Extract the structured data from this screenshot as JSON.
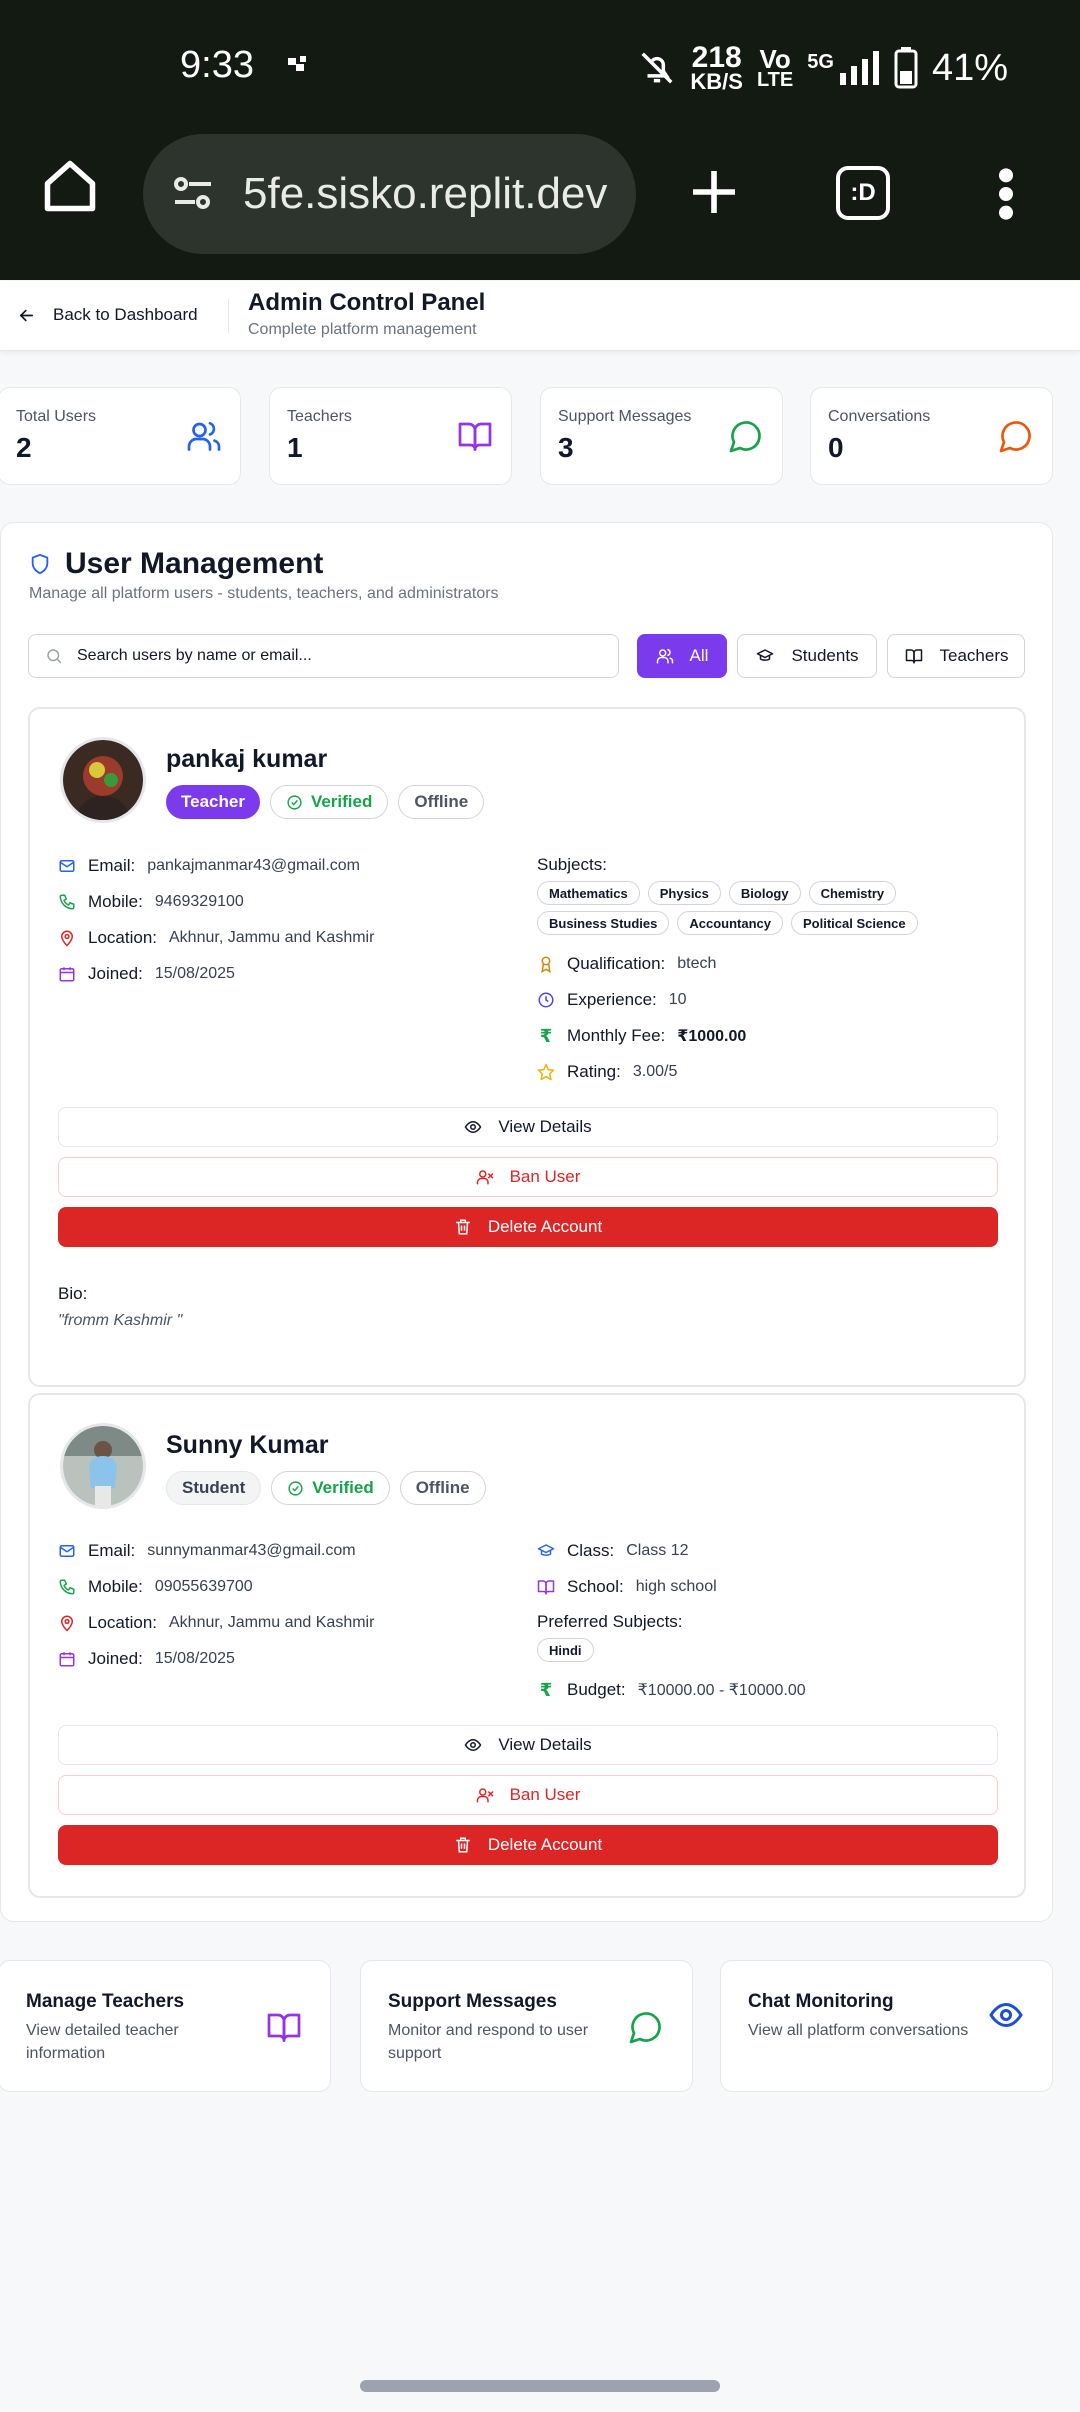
{
  "status_bar": {
    "time": "9:33",
    "net_speed_value": "218",
    "net_speed_unit": "KB/S",
    "volte_top": "Vo",
    "volte_bottom": "LTE",
    "network": "5G",
    "battery": "41%"
  },
  "browser": {
    "url": "5fe.sisko.replit.dev",
    "tabs_label": ":D"
  },
  "header": {
    "back_label": "Back to Dashboard",
    "title": "Admin Control Panel",
    "subtitle": "Complete platform management"
  },
  "stats": [
    {
      "label": "Total Users",
      "value": "2",
      "icon": "users-icon",
      "color": "#2563eb"
    },
    {
      "label": "Teachers",
      "value": "1",
      "icon": "book-open-icon",
      "color": "#9333ea"
    },
    {
      "label": "Support Messages",
      "value": "3",
      "icon": "message-circle-icon",
      "color": "#16a34a"
    },
    {
      "label": "Conversations",
      "value": "0",
      "icon": "message-circle-icon",
      "color": "#ea580c"
    }
  ],
  "user_management": {
    "title": "User Management",
    "subtitle": "Manage all platform users - students, teachers, and administrators",
    "search_placeholder": "Search users by name or email...",
    "filters": {
      "all": "All",
      "students": "Students",
      "teachers": "Teachers"
    }
  },
  "labels": {
    "email": "Email:",
    "mobile": "Mobile:",
    "location": "Location:",
    "joined": "Joined:",
    "subjects": "Subjects:",
    "qualification": "Qualification:",
    "experience": "Experience:",
    "monthly_fee": "Monthly Fee:",
    "rating": "Rating:",
    "class": "Class:",
    "school": "School:",
    "preferred_subjects": "Preferred Subjects:",
    "budget": "Budget:",
    "view_details": "View Details",
    "ban_user": "Ban User",
    "delete_account": "Delete Account",
    "bio": "Bio:"
  },
  "users": [
    {
      "name": "pankaj kumar",
      "role": "Teacher",
      "verified": "Verified",
      "presence": "Offline",
      "email": "pankajmanmar43@gmail.com",
      "mobile": "9469329100",
      "location": "Akhnur, Jammu and Kashmir",
      "joined": "15/08/2025",
      "subjects": [
        "Mathematics",
        "Physics",
        "Biology",
        "Chemistry",
        "Business Studies",
        "Accountancy",
        "Political Science"
      ],
      "qualification": "btech",
      "experience": "10",
      "monthly_fee": "₹1000.00",
      "rating": "3.00/5",
      "bio": "\"fromm Kashmir \""
    },
    {
      "name": "Sunny Kumar",
      "role": "Student",
      "verified": "Verified",
      "presence": "Offline",
      "email": "sunnymanmar43@gmail.com",
      "mobile": "09055639700",
      "location": "Akhnur, Jammu and Kashmir",
      "joined": "15/08/2025",
      "class": "Class 12",
      "school": "high school",
      "preferred_subjects": [
        "Hindi"
      ],
      "budget": "₹10000.00 - ₹10000.00"
    }
  ],
  "quick_links": [
    {
      "title": "Manage Teachers",
      "desc": "View detailed teacher information",
      "icon": "book-open-icon",
      "color": "#9333ea"
    },
    {
      "title": "Support Messages",
      "desc": "Monitor and respond to user support",
      "icon": "message-circle-icon",
      "color": "#16a34a"
    },
    {
      "title": "Chat Monitoring",
      "desc": "View all platform conversations",
      "icon": "eye-icon",
      "color": "#1d4ed8"
    }
  ]
}
